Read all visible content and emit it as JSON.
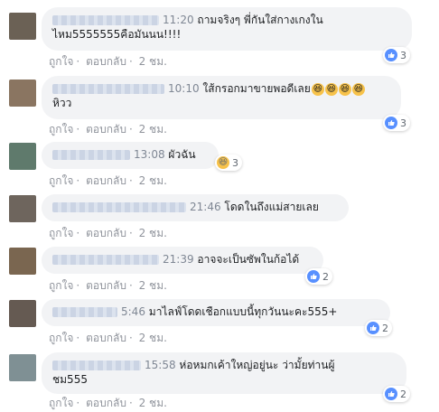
{
  "actions": {
    "like": "ถูกใจ",
    "reply": "ตอบกลับ",
    "sep": "·"
  },
  "comments": [
    {
      "time": "11:20",
      "text1": "ถามจริงๆ พี่กันใส่กางเกงใน",
      "text2": "ไหม5555555คือมันนน!!!!",
      "ago": "2 ชม.",
      "reaction_icon": "like-icon",
      "reaction_count": "3"
    },
    {
      "time": "10:10",
      "text1": "ใส้กรอกมาขายพอดีเลย",
      "emoji": "😆😆😆😆",
      "text2": "หิวว",
      "ago": "2 ชม.",
      "reaction_icon": "like-icon",
      "reaction_count": "3"
    },
    {
      "time": "13:08",
      "text1": "ผัวฉัน",
      "ago": "2 ชม.",
      "reaction_icon": "haha-icon",
      "reaction_count": "3"
    },
    {
      "time": "21:46",
      "text1": "โดดในถึงแม่สายเลย",
      "ago": "2 ชม."
    },
    {
      "time": "21:39",
      "text1": "อาจจะเป็นซัพในก้อได้",
      "ago": "2 ชม.",
      "reaction_icon": "like-icon",
      "reaction_count": "2"
    },
    {
      "time": "5:46",
      "text1": "มาไลฟ์โดดเชือกแบบนี้ทุกวันนะคะ555+",
      "ago": "2 ชม.",
      "reaction_icon": "like-icon",
      "reaction_count": "2"
    },
    {
      "time": "15:58",
      "text1": "ห่อหมกเค้าใหญ่อยู่นะ ว่ามั้ยท่านผู้",
      "text2": "ชม555",
      "ago": "2 ชม.",
      "reaction_icon": "like-icon",
      "reaction_count": "2"
    }
  ]
}
